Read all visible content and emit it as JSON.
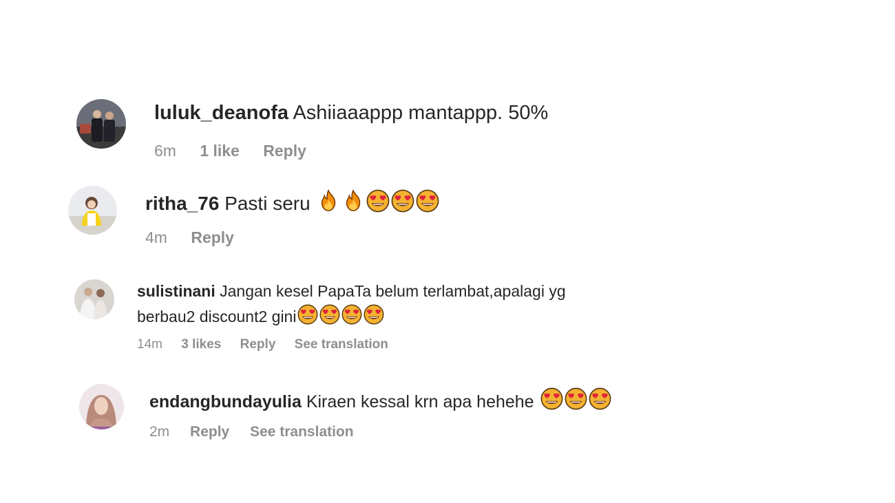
{
  "comments": [
    {
      "username": "luluk_deanofa",
      "text": "Ashiiaaappp mantappp. 50%",
      "time": "6m",
      "likes": "1 like",
      "reply": "Reply",
      "avatar_icon": "avatar-photo"
    },
    {
      "username": "ritha_76",
      "text": "Pasti seru",
      "emojis": [
        "fire-emoji",
        "fire-emoji",
        "heart-eyes-emoji",
        "heart-eyes-emoji",
        "heart-eyes-emoji"
      ],
      "time": "4m",
      "reply": "Reply",
      "avatar_icon": "avatar-photo"
    },
    {
      "username": "sulistinani",
      "text_line1": "Jangan kesel PapaTa belum terlambat,apalagi yg",
      "text_line2": "berbau2 discount2 gini",
      "emojis": [
        "heart-eyes-emoji",
        "heart-eyes-emoji",
        "heart-eyes-emoji",
        "heart-eyes-emoji"
      ],
      "time": "14m",
      "likes": "3 likes",
      "reply": "Reply",
      "translation": "See translation",
      "avatar_icon": "avatar-photo"
    },
    {
      "username": "endangbundayulia",
      "text": "Kiraen kessal krn apa hehehe",
      "emojis": [
        "heart-eyes-emoji",
        "heart-eyes-emoji",
        "heart-eyes-emoji"
      ],
      "time": "2m",
      "reply": "Reply",
      "translation": "See translation",
      "avatar_icon": "avatar-photo"
    }
  ],
  "colors": {
    "text": "#262626",
    "meta": "#8e8e8e",
    "background": "#ffffff"
  }
}
